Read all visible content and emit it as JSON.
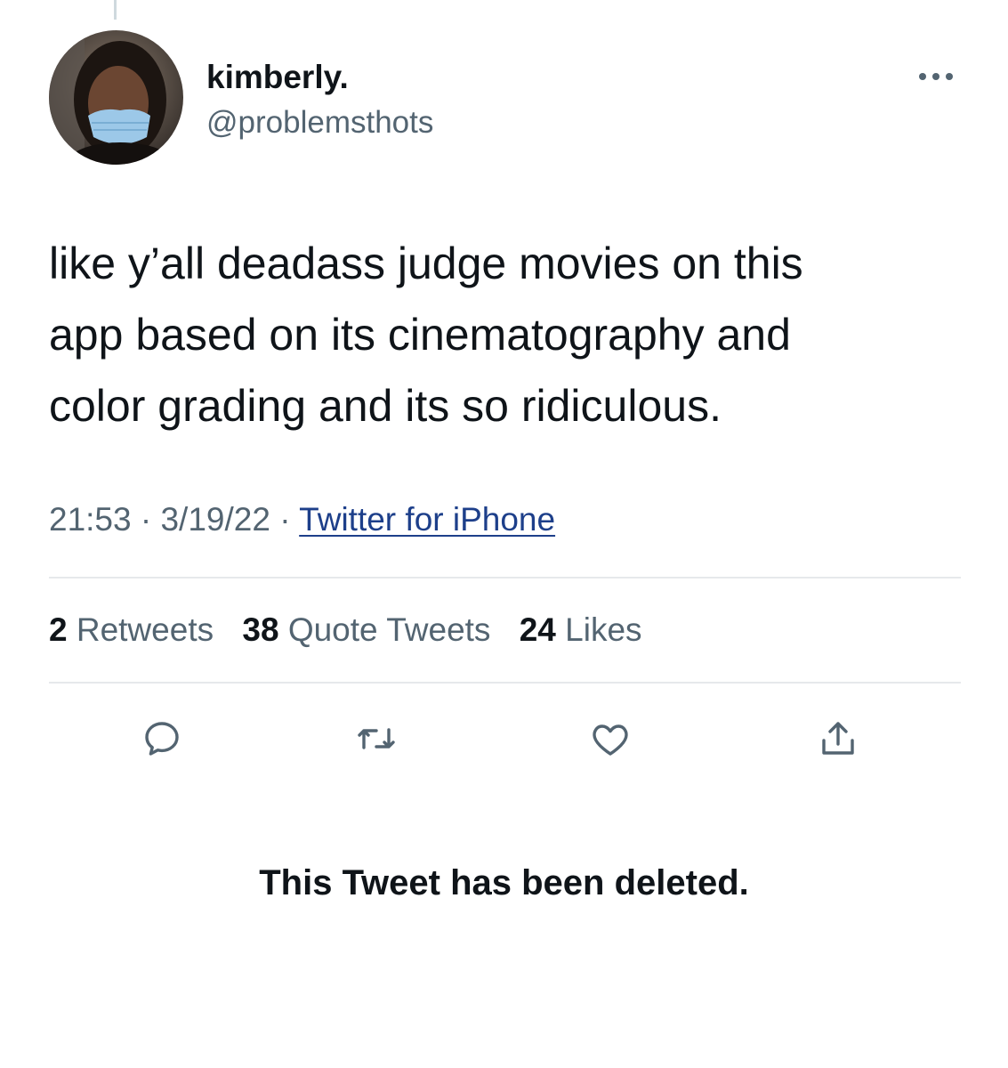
{
  "tweet": {
    "author": {
      "display_name": "kimberly.",
      "handle": "@problemsthots"
    },
    "text": "like y’all deadass judge movies on this\napp based on its cinematography and\ncolor grading and its so ridiculous.",
    "time": "21:53",
    "date": "3/19/22",
    "separator": "·",
    "source": "Twitter for iPhone"
  },
  "stats": {
    "retweets": {
      "count": "2",
      "label": "Retweets"
    },
    "quote_tweets": {
      "count": "38",
      "label": "Quote Tweets"
    },
    "likes": {
      "count": "24",
      "label": "Likes"
    }
  },
  "actions": [
    {
      "icon": "reply-icon"
    },
    {
      "icon": "retweet-icon"
    },
    {
      "icon": "like-icon"
    },
    {
      "icon": "share-icon"
    }
  ],
  "notice": "This Tweet has been deleted.",
  "colors": {
    "text": "#0f1419",
    "secondary_text": "#536471",
    "link": "#1d3f8a",
    "divider": "#e6e9eb"
  }
}
